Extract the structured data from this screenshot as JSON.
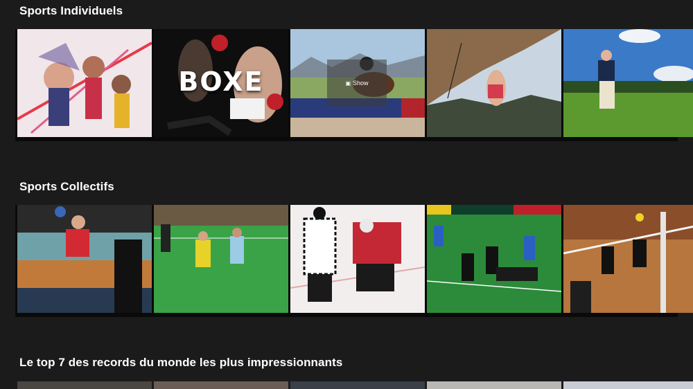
{
  "sections": [
    {
      "title": "Sports Individuels",
      "tiles": [
        {
          "name": "athletics"
        },
        {
          "name": "boxing",
          "caption": "BOXE"
        },
        {
          "name": "equestrian",
          "overlay": "Show"
        },
        {
          "name": "climbing"
        },
        {
          "name": "golf"
        }
      ]
    },
    {
      "title": "Sports Collectifs",
      "tiles": [
        {
          "name": "handball"
        },
        {
          "name": "field-hockey"
        },
        {
          "name": "ice-hockey"
        },
        {
          "name": "rugby"
        },
        {
          "name": "volleyball"
        }
      ]
    },
    {
      "title": "Le top 7 des records du monde les plus impressionnants"
    }
  ],
  "colors": {
    "background": "#1b1b1b",
    "strip": "#0a0a0a"
  }
}
